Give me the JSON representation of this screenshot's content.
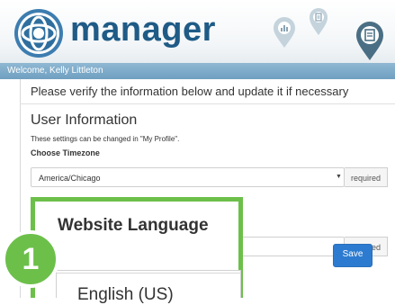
{
  "header": {
    "app_name": "manager",
    "welcome": "Welcome, Kelly Littleton"
  },
  "main": {
    "intro": "Please verify the information below and update it if necessary",
    "section_title": "User Information",
    "help_text": "These settings can be changed in \"My Profile\".",
    "timezone": {
      "label": "Choose Timezone",
      "value": "America/Chicago",
      "required": "required"
    },
    "language_field": {
      "required": "required"
    },
    "save_label": "Save"
  },
  "callout": {
    "badge_number": "1",
    "title": "Website Language",
    "value": "English (US)"
  },
  "icons": {
    "logo": "globe-logo-icon",
    "pin_chart": "chart-pin-icon",
    "pin_document": "document-pin-icon",
    "pin_active": "active-pin-icon"
  },
  "colors": {
    "brand": "#1f5b86",
    "welcome_bar": "#7aa8c7",
    "save_button": "#2c7bd0",
    "highlight": "#6cc04a"
  }
}
